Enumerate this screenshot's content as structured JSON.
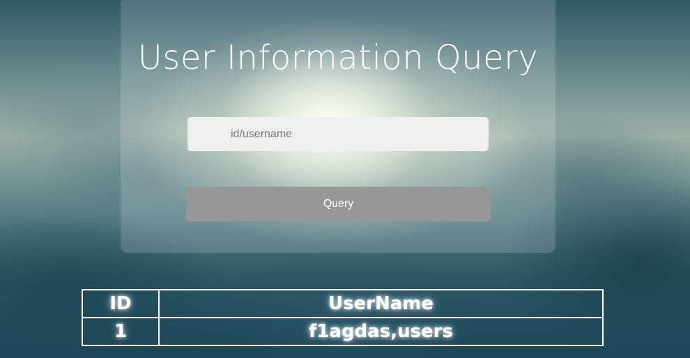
{
  "page": {
    "title": "User Information Query"
  },
  "form": {
    "input_placeholder": "id/username",
    "input_value": "",
    "button_label": "Query"
  },
  "results": {
    "headers": [
      "ID",
      "UserName"
    ],
    "rows": [
      [
        "1",
        "f1agdas,users"
      ]
    ]
  },
  "colors": {
    "panel": "rgba(255,255,255,0.16)",
    "input_bg": "#efefef",
    "button_bg": "#979797",
    "text": "#ffffff"
  }
}
